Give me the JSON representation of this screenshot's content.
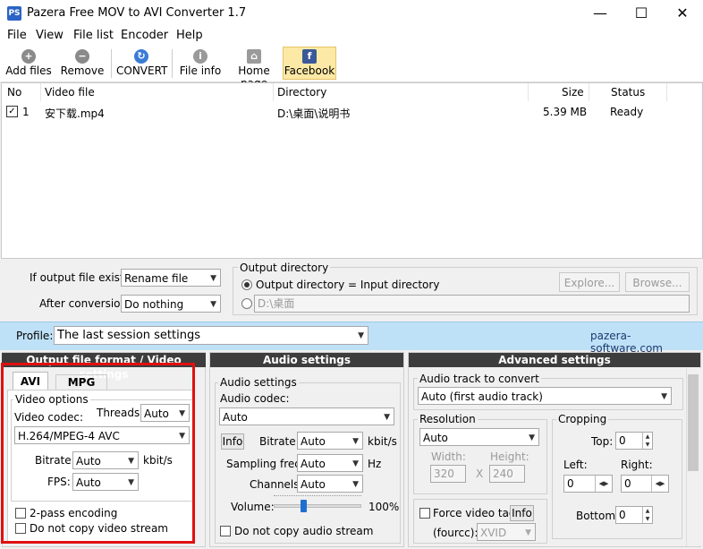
{
  "window": {
    "app_icon_text": "PS",
    "title": "Pazera Free MOV to AVI Converter 1.7"
  },
  "menu": [
    "File",
    "View",
    "File list",
    "Encoder",
    "Help"
  ],
  "toolbar": {
    "add_files": "Add files",
    "remove": "Remove",
    "convert": "CONVERT",
    "file_info": "File info",
    "home_page": "Home page",
    "facebook": "Facebook"
  },
  "file_list": {
    "columns": [
      "No",
      "Video file",
      "Directory",
      "Size",
      "Status"
    ],
    "rows": [
      {
        "no": "1",
        "file": "安下载.mp4",
        "directory": "D:\\桌面\\说明书",
        "size": "5.39 MB",
        "status": "Ready",
        "checked": true
      }
    ]
  },
  "output": {
    "if_exists_label": "If output file exists:",
    "if_exists_value": "Rename file",
    "after_label": "After conversion:",
    "after_value": "Do nothing",
    "dir_title": "Output directory",
    "radio_same": "Output directory = Input directory",
    "radio_custom": "D:\\桌面",
    "explore": "Explore...",
    "browse": "Browse..."
  },
  "profile": {
    "label": "Profile:",
    "value": "The last session settings",
    "link": "pazera-software.com"
  },
  "video_panel": {
    "header": "Output file format / Video settings",
    "tabs": [
      "AVI",
      "MPG"
    ],
    "group": "Video options",
    "codec_label": "Video codec:",
    "threads_label": "Threads:",
    "threads_value": "Auto",
    "codec_value": "H.264/MPEG-4 AVC",
    "bitrate_label": "Bitrate:",
    "bitrate_value": "Auto",
    "bitrate_unit": "kbit/s",
    "fps_label": "FPS:",
    "fps_value": "Auto",
    "twopass": "2-pass encoding",
    "nocopy": "Do not copy video stream"
  },
  "audio_panel": {
    "header": "Audio settings",
    "group": "Audio settings",
    "codec_label": "Audio codec:",
    "codec_value": "Auto",
    "info": "Info",
    "bitrate_label": "Bitrate:",
    "bitrate_value": "Auto",
    "bitrate_unit": "kbit/s",
    "sampling_label": "Sampling freq.:",
    "sampling_value": "Auto",
    "sampling_unit": "Hz",
    "channels_label": "Channels:",
    "channels_value": "Auto",
    "volume_label": "Volume:",
    "volume_value": "100%",
    "nocopy": "Do not copy audio stream"
  },
  "advanced_panel": {
    "header": "Advanced settings",
    "track_label": "Audio track to convert",
    "track_value": "Auto (first audio track)",
    "resolution_title": "Resolution",
    "resolution_value": "Auto",
    "width_label": "Width:",
    "width_value": "320",
    "height_label": "Height:",
    "height_value": "240",
    "x": "X",
    "cropping_title": "Cropping",
    "top_label": "Top:",
    "top_value": "0",
    "left_label": "Left:",
    "left_value": "0",
    "right_label": "Right:",
    "right_value": "0",
    "bottom_label": "Bottom:",
    "bottom_value": "0",
    "force_tag": "Force video tag",
    "info": "Info",
    "fourcc_label": "(fourcc):",
    "fourcc_value": "XVID"
  },
  "colors": {
    "profile_bg": "#bfe1f7",
    "panel_header": "#3d3d3d",
    "highlight": "#e01010",
    "facebook_bg": "#fde9a6"
  }
}
